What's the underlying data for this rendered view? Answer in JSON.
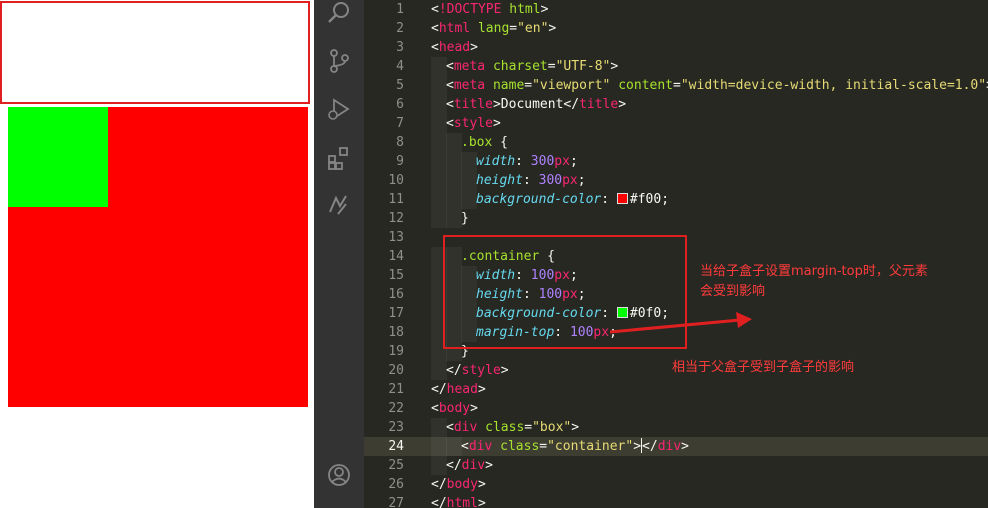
{
  "preview": {
    "box_color": "#ff0000",
    "container_color": "#00ff00",
    "outline_color": "#e02020"
  },
  "activity_bar": {
    "icons": [
      "search-icon",
      "source-control-icon",
      "run-debug-icon",
      "extensions-icon",
      "remote-explorer-icon",
      "account-icon"
    ]
  },
  "editor": {
    "lines": [
      {
        "n": "1",
        "code": "<!DOCTYPE html>"
      },
      {
        "n": "2",
        "code": "<html lang=\"en\">"
      },
      {
        "n": "3",
        "code": "<head>"
      },
      {
        "n": "4",
        "code": "<meta charset=\"UTF-8\">"
      },
      {
        "n": "5",
        "code": "<meta name=\"viewport\" content=\"width=device-width, initial-scale=1.0\">"
      },
      {
        "n": "6",
        "code": "<title>Document</title>"
      },
      {
        "n": "7",
        "code": "<style>"
      },
      {
        "n": "8",
        "code": ".box {"
      },
      {
        "n": "9",
        "code": "width: 300px;"
      },
      {
        "n": "10",
        "code": "height: 300px;"
      },
      {
        "n": "11",
        "code": "background-color: #f00;"
      },
      {
        "n": "12",
        "code": "}"
      },
      {
        "n": "13",
        "code": ""
      },
      {
        "n": "14",
        "code": ".container {"
      },
      {
        "n": "15",
        "code": "width: 100px;"
      },
      {
        "n": "16",
        "code": "height: 100px;"
      },
      {
        "n": "17",
        "code": "background-color: #0f0;"
      },
      {
        "n": "18",
        "code": "margin-top: 100px;"
      },
      {
        "n": "19",
        "code": "}"
      },
      {
        "n": "20",
        "code": "</style>"
      },
      {
        "n": "21",
        "code": "</head>"
      },
      {
        "n": "22",
        "code": "<body>"
      },
      {
        "n": "23",
        "code": "<div class=\"box\">"
      },
      {
        "n": "24",
        "code": "<div class=\"container\"></div>"
      },
      {
        "n": "25",
        "code": "</div>"
      },
      {
        "n": "26",
        "code": "</body>"
      },
      {
        "n": "27",
        "code": "</html>"
      }
    ],
    "current_line": "24"
  },
  "annotations": {
    "note_1": "当给子盒子设置margin-top时，父元素会受到影响",
    "note_2": "相当于父盒子受到子盒子的影响",
    "color": "#ff3b3b"
  }
}
